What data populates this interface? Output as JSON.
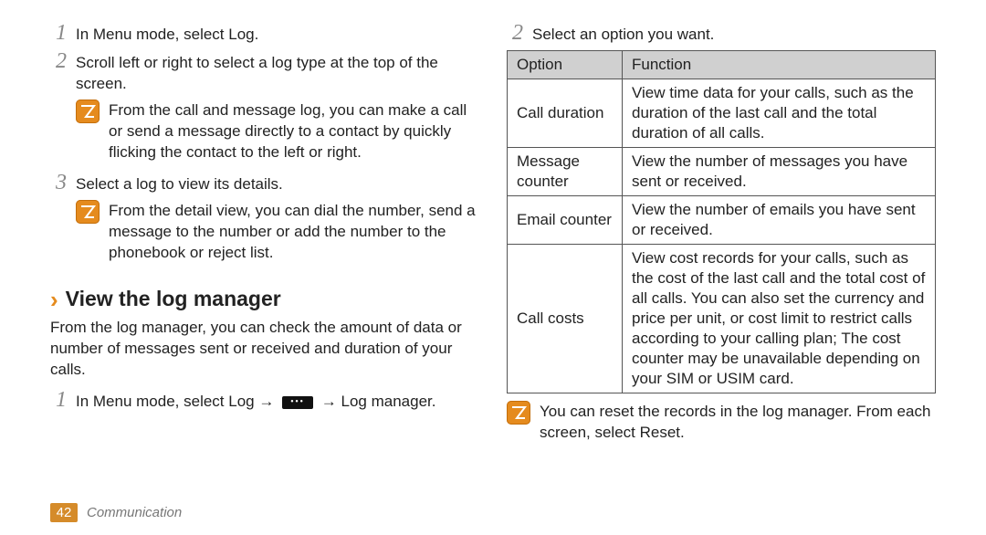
{
  "left": {
    "step1": {
      "num": "1",
      "text": "In Menu mode, select Log."
    },
    "step2": {
      "num": "2",
      "text": "Scroll left or right to select a log type at the top of the screen."
    },
    "note1": "From the call and message log, you can make a call or send a message directly to a contact by quickly flicking the contact to the left or right.",
    "step3": {
      "num": "3",
      "text": "Select a log to view its details."
    },
    "note2": "From the detail view, you can dial the number, send a message to the number or add the number to the phonebook or reject list.",
    "section_title": "View the log manager",
    "intro": "From the log manager, you can check the amount of data or number of messages sent or received and duration of your calls.",
    "nav_step": {
      "num": "1",
      "pre": "In Menu mode, select Log → ",
      "post": " → Log manager."
    }
  },
  "right": {
    "step2": {
      "num": "2",
      "text": "Select an option you want."
    },
    "headers": {
      "opt": "Option",
      "func": "Function"
    },
    "rows": [
      {
        "opt": "Call duration",
        "func": "View time data for your calls, such as the duration of the last call and the total duration of all calls."
      },
      {
        "opt": "Message counter",
        "func": "View the number of messages you have sent or received."
      },
      {
        "opt": "Email counter",
        "func": "View the number of emails you have sent or received."
      },
      {
        "opt": "Call costs",
        "func": "View cost records for your calls, such as the cost of the last call and the total cost of all calls. You can also set the currency and price per unit, or cost limit to restrict calls according to your calling plan; The cost counter may be unavailable depending on your SIM or USIM card."
      }
    ],
    "note": "You can reset the records in the log manager. From each screen, select Reset."
  },
  "footer": {
    "page": "42",
    "section": "Communication"
  }
}
